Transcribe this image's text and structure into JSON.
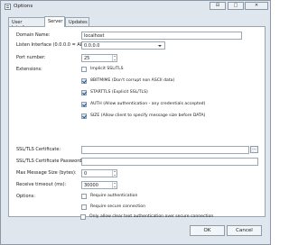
{
  "window": {
    "title": "Options",
    "icon": "window-app-icon"
  },
  "tabs": [
    {
      "label": "User Interface",
      "active": false
    },
    {
      "label": "Server",
      "active": true
    },
    {
      "label": "Updates",
      "active": false
    }
  ],
  "form": {
    "domain_name": {
      "label": "Domain Name:",
      "value": "localhost"
    },
    "listen_interface": {
      "label": "Listen Interface (0.0.0.0 = ALL):",
      "value": "0.0.0.0"
    },
    "port_number": {
      "label": "Port number:",
      "value": "25"
    },
    "extensions": {
      "label": "Extensions:",
      "items": [
        {
          "label": "Implicit SSL/TLS",
          "checked": false
        },
        {
          "label": "8BITMIME (Don't corrupt non ASCII data)",
          "checked": true
        },
        {
          "label": "STARTTLS (Explicit SSL/TLS)",
          "checked": true
        },
        {
          "label": "AUTH (Allow authentication - any credentials accepted)",
          "checked": true
        },
        {
          "label": "SIZE (Allow client to specify message size before DATA)",
          "checked": true
        }
      ]
    },
    "ssl_certificate": {
      "label": "SSL/TLS Certificate:",
      "value": "",
      "browse_label": "..."
    },
    "ssl_certificate_password": {
      "label": "SSL/TLS Certificate Password:",
      "value": ""
    },
    "max_message_size": {
      "label": "Max Message Size (bytes):",
      "value": "0"
    },
    "receive_timeout": {
      "label": "Receive timeout (ms):",
      "value": "30000"
    },
    "options": {
      "label": "Options:",
      "items": [
        {
          "label": "Require authentication",
          "checked": false
        },
        {
          "label": "Require secure connection",
          "checked": false
        },
        {
          "label": "Only allow clear text authentication over secure connection",
          "checked": false
        }
      ]
    }
  },
  "buttons": {
    "ok": "OK",
    "cancel": "Cancel"
  },
  "titlebar_buttons": {
    "restore": "⊟",
    "maximize": "□",
    "close": "✕"
  }
}
